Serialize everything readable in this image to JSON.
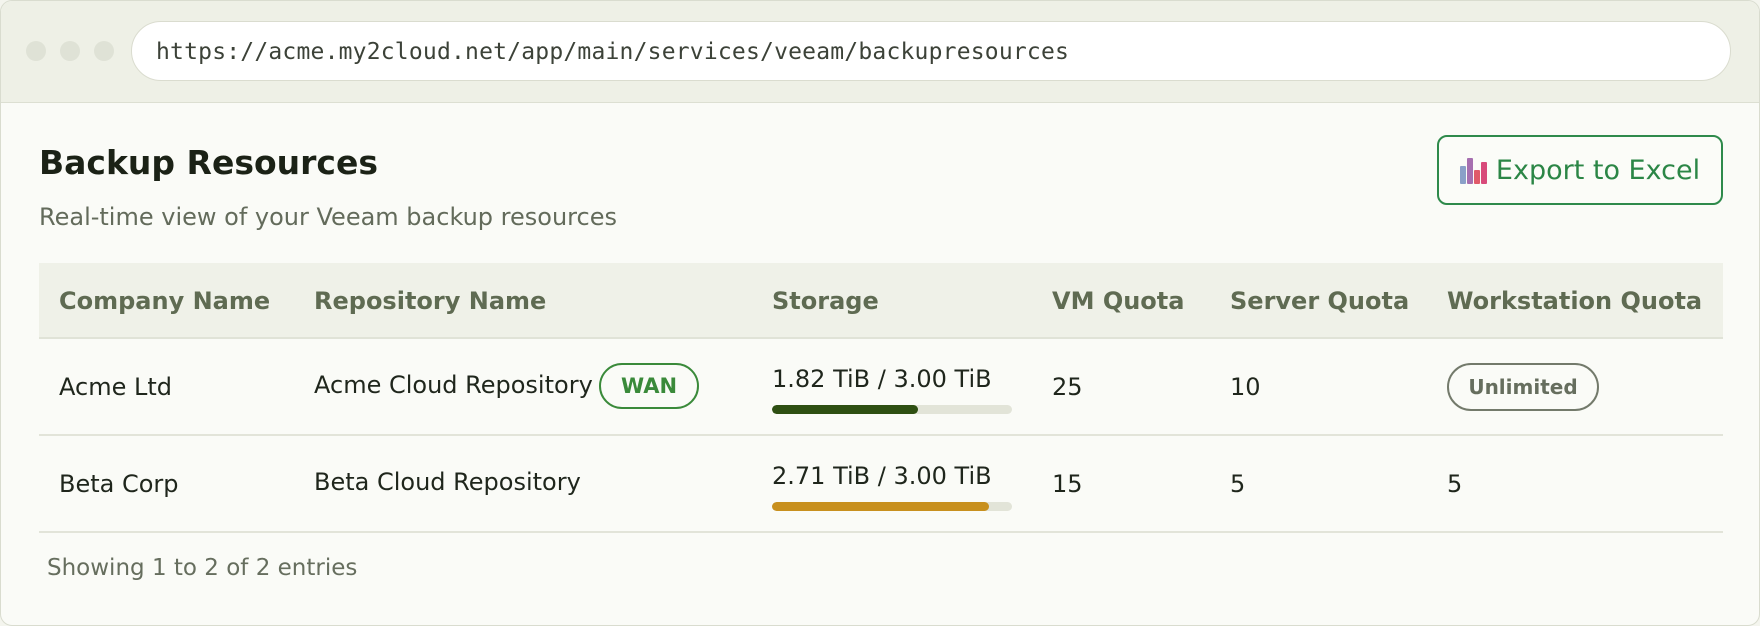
{
  "browser": {
    "url": "https://acme.my2cloud.net/app/main/services/veeam/backupresources"
  },
  "header": {
    "title": "Backup Resources",
    "subtitle": "Real-time view of your Veeam backup resources",
    "export_label": "Export to Excel",
    "export_icon": "excel-chart-icon"
  },
  "table": {
    "columns": [
      "Company Name",
      "Repository Name",
      "Storage",
      "VM Quota",
      "Server Quota",
      "Workstation Quota"
    ],
    "rows": [
      {
        "company": "Acme Ltd",
        "repository": "Acme Cloud Repository",
        "badge": "WAN",
        "storage": "1.82 TiB / 3.00 TiB",
        "storage_used": 1.82,
        "storage_total": 3.0,
        "storage_color": "#2e4f12",
        "vm_quota": "25",
        "server_quota": "10",
        "workstation_quota": "Unlimited"
      },
      {
        "company": "Beta Corp",
        "repository": "Beta Cloud Repository",
        "storage": "2.71 TiB / 3.00 TiB",
        "storage_used": 2.71,
        "storage_total": 3.0,
        "storage_color": "#c8901e",
        "vm_quota": "15",
        "server_quota": "5",
        "workstation_quota": "5"
      }
    ]
  },
  "footer": {
    "info": "Showing 1 to 2 of 2 entries"
  },
  "colors": {
    "accent": "#2e8a4b",
    "badge_wan": "#3a8a3a"
  }
}
